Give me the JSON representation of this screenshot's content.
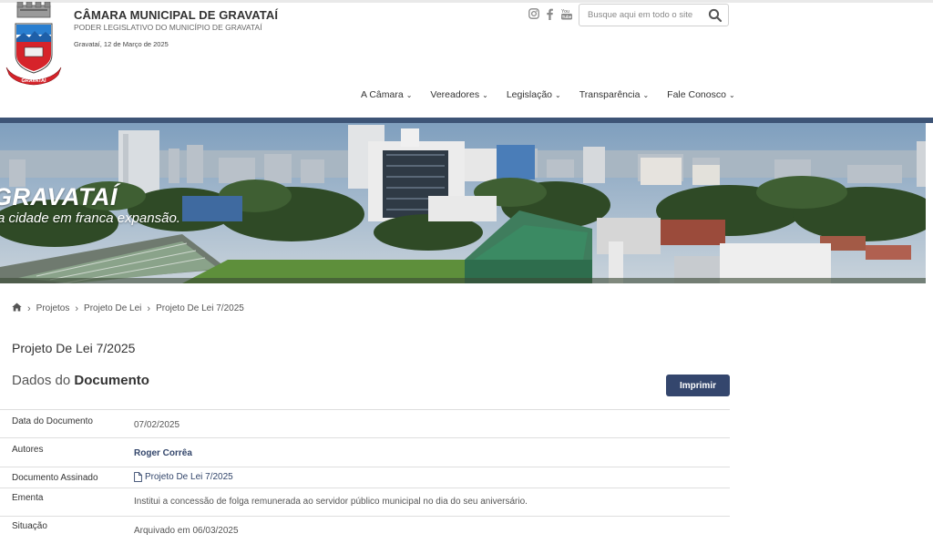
{
  "header": {
    "title": "CÂMARA MUNICIPAL DE GRAVATAÍ",
    "subtitle": "PODER LEGISLATIVO DO MUNICÍPIO DE GRAVATAÍ",
    "date": "Gravataí, 12 de Março de 2025",
    "social_icons": [
      "instagram-icon",
      "facebook-icon",
      "youtube-icon"
    ],
    "search": {
      "placeholder": "Busque aqui em todo o site",
      "value": ""
    },
    "logo_text": "GRAVATAÍ"
  },
  "nav": {
    "items": [
      {
        "label": "A Câmara"
      },
      {
        "label": "Vereadores"
      },
      {
        "label": "Legislação"
      },
      {
        "label": "Transparência"
      },
      {
        "label": "Fale Conosco"
      }
    ]
  },
  "banner": {
    "title": "GRAVATAÍ",
    "slogan": "a cidade em franca expansão."
  },
  "breadcrumb": {
    "items": [
      "Projetos",
      "Projeto De Lei",
      "Projeto De Lei 7/2025"
    ]
  },
  "page": {
    "title": "Projeto De Lei 7/2025",
    "section_prefix": "Dados do",
    "section_bold": "Documento",
    "print_label": "Imprimir"
  },
  "document": {
    "rows": [
      {
        "label": "Data do Documento",
        "value": "07/02/2025"
      },
      {
        "label": "Autores",
        "value": "Roger Corrêa"
      },
      {
        "label": "Documento Assinado",
        "value": "Projeto De Lei 7/2025"
      },
      {
        "label": "Ementa",
        "value": "Institui a concessão de folga remunerada ao servidor público municipal no dia do seu aniversário."
      },
      {
        "label": "Situação",
        "value": "Arquivado em 06/03/2025"
      }
    ]
  },
  "colors": {
    "accent": "#34466d",
    "band": "#3d5476",
    "link": "#33466b"
  }
}
